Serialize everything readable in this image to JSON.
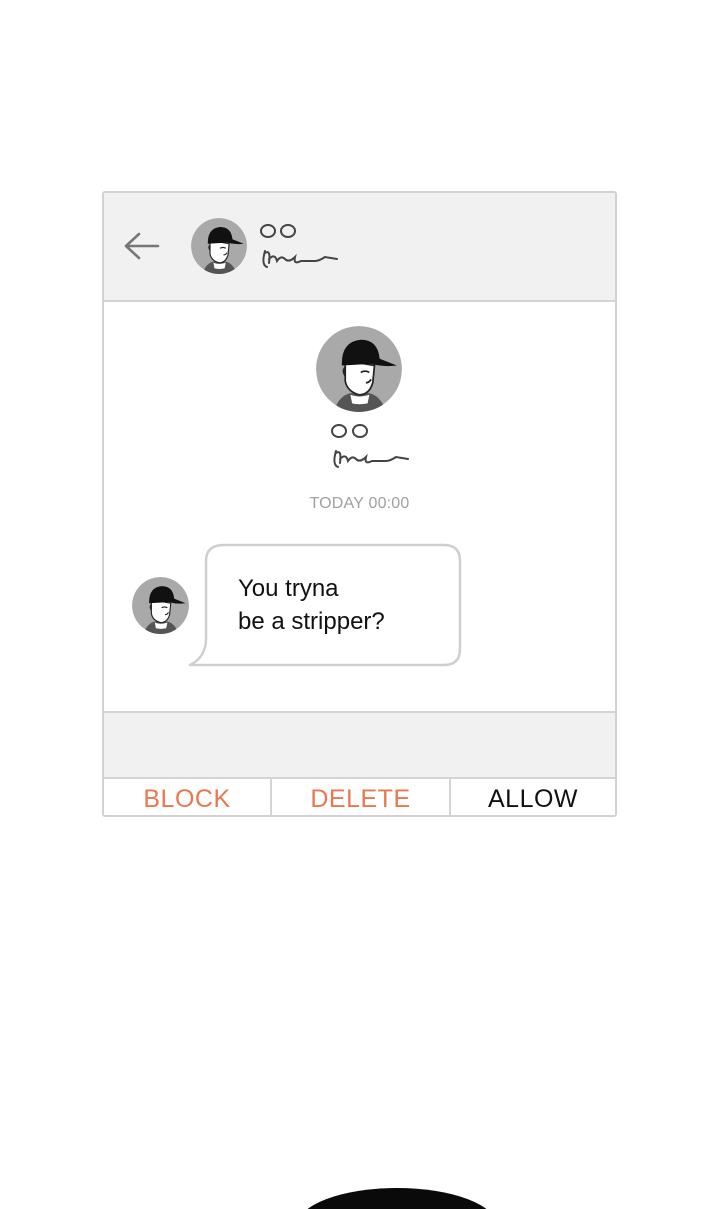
{
  "header": {
    "back_icon": "arrow-left-icon",
    "name_placeholder": "oo",
    "subtitle_signature": "Mr-n"
  },
  "profile": {
    "name_placeholder": "oo",
    "subtitle_signature": "Mr-n"
  },
  "chat": {
    "timestamp": "TODAY 00:00",
    "messages": [
      {
        "text": "You tryna\nbe a stripper?"
      }
    ]
  },
  "actions": {
    "block_label": "BLOCK",
    "delete_label": "DELETE",
    "allow_label": "ALLOW"
  },
  "colors": {
    "accent": "#e8784f",
    "border": "#d4d4d4",
    "header_bg": "#f1f1f1",
    "avatar_bg": "#a9a9a9"
  }
}
